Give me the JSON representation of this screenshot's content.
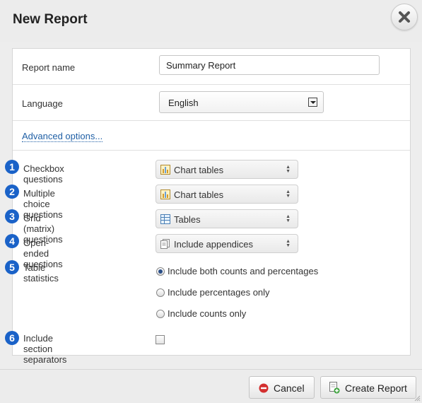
{
  "dialog": {
    "title": "New Report"
  },
  "form": {
    "report_name_label": "Report name",
    "report_name_value": "Summary Report",
    "language_label": "Language",
    "language_value": "English",
    "advanced_link": "Advanced options..."
  },
  "questions": [
    {
      "number": "1",
      "label": "Checkbox questions",
      "option": "Chart tables",
      "icon": "chart-icon"
    },
    {
      "number": "2",
      "label": "Multiple choice questions",
      "option": "Chart tables",
      "icon": "chart-icon"
    },
    {
      "number": "3",
      "label": "Grid (matrix) questions",
      "option": "Tables",
      "icon": "table-icon"
    },
    {
      "number": "4",
      "label": "Open-ended questions",
      "option": "Include appendices",
      "icon": "appendix-icon"
    }
  ],
  "table_statistics": {
    "number": "5",
    "label": "Table statistics",
    "options": [
      {
        "label": "Include both counts and percentages",
        "checked": true
      },
      {
        "label": "Include percentages only",
        "checked": false
      },
      {
        "label": "Include counts only",
        "checked": false
      }
    ]
  },
  "section_separators": {
    "number": "6",
    "label": "Include section separators",
    "checked": false
  },
  "footer": {
    "cancel_label": "Cancel",
    "create_label": "Create Report"
  },
  "colors": {
    "badge": "#1a62c8",
    "link": "#1f5fa5",
    "cancel_icon": "#d32f2f",
    "create_icon": "#3aa23a"
  }
}
